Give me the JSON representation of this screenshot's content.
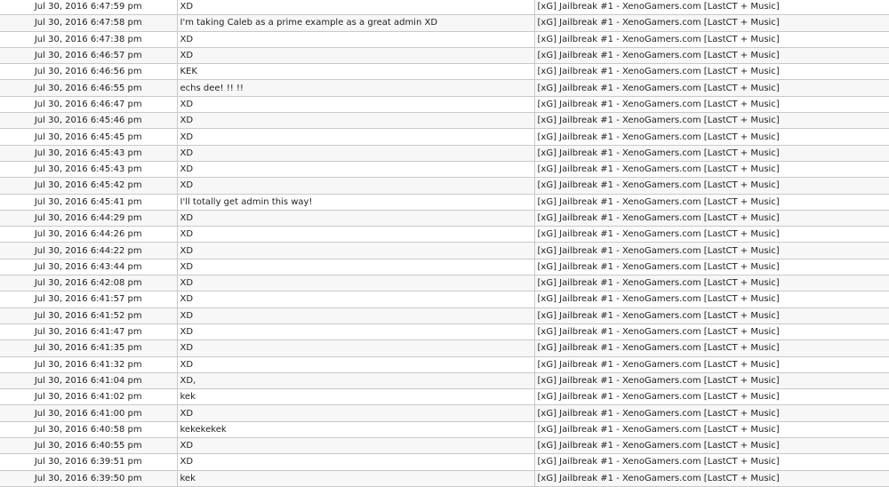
{
  "chat_log": {
    "rows": [
      {
        "date": "Jul 30, 2016 6:47:59 pm",
        "message": "XD",
        "server": "[xG] Jailbreak #1 - XenoGamers.com [LastCT + Music]"
      },
      {
        "date": "Jul 30, 2016 6:47:58 pm",
        "message": "I'm taking Caleb as a prime example as a great admin XD",
        "server": "[xG] Jailbreak #1 - XenoGamers.com [LastCT + Music]"
      },
      {
        "date": "Jul 30, 2016 6:47:38 pm",
        "message": "XD",
        "server": "[xG] Jailbreak #1 - XenoGamers.com [LastCT + Music]"
      },
      {
        "date": "Jul 30, 2016 6:46:57 pm",
        "message": "XD",
        "server": "[xG] Jailbreak #1 - XenoGamers.com [LastCT + Music]"
      },
      {
        "date": "Jul 30, 2016 6:46:56 pm",
        "message": "KEK",
        "server": "[xG] Jailbreak #1 - XenoGamers.com [LastCT + Music]"
      },
      {
        "date": "Jul 30, 2016 6:46:55 pm",
        "message": "echs dee! !! !!",
        "server": "[xG] Jailbreak #1 - XenoGamers.com [LastCT + Music]"
      },
      {
        "date": "Jul 30, 2016 6:46:47 pm",
        "message": "XD",
        "server": "[xG] Jailbreak #1 - XenoGamers.com [LastCT + Music]"
      },
      {
        "date": "Jul 30, 2016 6:45:46 pm",
        "message": "XD",
        "server": "[xG] Jailbreak #1 - XenoGamers.com [LastCT + Music]"
      },
      {
        "date": "Jul 30, 2016 6:45:45 pm",
        "message": "XD",
        "server": "[xG] Jailbreak #1 - XenoGamers.com [LastCT + Music]"
      },
      {
        "date": "Jul 30, 2016 6:45:43 pm",
        "message": "XD",
        "server": "[xG] Jailbreak #1 - XenoGamers.com [LastCT + Music]"
      },
      {
        "date": "Jul 30, 2016 6:45:43 pm",
        "message": "XD",
        "server": "[xG] Jailbreak #1 - XenoGamers.com [LastCT + Music]"
      },
      {
        "date": "Jul 30, 2016 6:45:42 pm",
        "message": "XD",
        "server": "[xG] Jailbreak #1 - XenoGamers.com [LastCT + Music]"
      },
      {
        "date": "Jul 30, 2016 6:45:41 pm",
        "message": "I'll totally get admin this way!",
        "server": "[xG] Jailbreak #1 - XenoGamers.com [LastCT + Music]"
      },
      {
        "date": "Jul 30, 2016 6:44:29 pm",
        "message": "XD",
        "server": "[xG] Jailbreak #1 - XenoGamers.com [LastCT + Music]"
      },
      {
        "date": "Jul 30, 2016 6:44:26 pm",
        "message": "XD",
        "server": "[xG] Jailbreak #1 - XenoGamers.com [LastCT + Music]"
      },
      {
        "date": "Jul 30, 2016 6:44:22 pm",
        "message": "XD",
        "server": "[xG] Jailbreak #1 - XenoGamers.com [LastCT + Music]"
      },
      {
        "date": "Jul 30, 2016 6:43:44 pm",
        "message": "XD",
        "server": "[xG] Jailbreak #1 - XenoGamers.com [LastCT + Music]"
      },
      {
        "date": "Jul 30, 2016 6:42:08 pm",
        "message": "XD",
        "server": "[xG] Jailbreak #1 - XenoGamers.com [LastCT + Music]"
      },
      {
        "date": "Jul 30, 2016 6:41:57 pm",
        "message": "XD",
        "server": "[xG] Jailbreak #1 - XenoGamers.com [LastCT + Music]"
      },
      {
        "date": "Jul 30, 2016 6:41:52 pm",
        "message": "XD",
        "server": "[xG] Jailbreak #1 - XenoGamers.com [LastCT + Music]"
      },
      {
        "date": "Jul 30, 2016 6:41:47 pm",
        "message": "XD",
        "server": "[xG] Jailbreak #1 - XenoGamers.com [LastCT + Music]"
      },
      {
        "date": "Jul 30, 2016 6:41:35 pm",
        "message": "XD",
        "server": "[xG] Jailbreak #1 - XenoGamers.com [LastCT + Music]"
      },
      {
        "date": "Jul 30, 2016 6:41:32 pm",
        "message": "XD",
        "server": "[xG] Jailbreak #1 - XenoGamers.com [LastCT + Music]"
      },
      {
        "date": "Jul 30, 2016 6:41:04 pm",
        "message": "XD,",
        "server": "[xG] Jailbreak #1 - XenoGamers.com [LastCT + Music]"
      },
      {
        "date": "Jul 30, 2016 6:41:02 pm",
        "message": "kek",
        "server": "[xG] Jailbreak #1 - XenoGamers.com [LastCT + Music]"
      },
      {
        "date": "Jul 30, 2016 6:41:00 pm",
        "message": "XD",
        "server": "[xG] Jailbreak #1 - XenoGamers.com [LastCT + Music]"
      },
      {
        "date": "Jul 30, 2016 6:40:58 pm",
        "message": "kekekekek",
        "server": "[xG] Jailbreak #1 - XenoGamers.com [LastCT + Music]"
      },
      {
        "date": "Jul 30, 2016 6:40:55 pm",
        "message": "XD",
        "server": "[xG] Jailbreak #1 - XenoGamers.com [LastCT + Music]"
      },
      {
        "date": "Jul 30, 2016 6:39:51 pm",
        "message": "XD",
        "server": "[xG] Jailbreak #1 - XenoGamers.com [LastCT + Music]"
      },
      {
        "date": "Jul 30, 2016 6:39:50 pm",
        "message": "kek",
        "server": "[xG] Jailbreak #1 - XenoGamers.com [LastCT + Music]"
      }
    ]
  }
}
